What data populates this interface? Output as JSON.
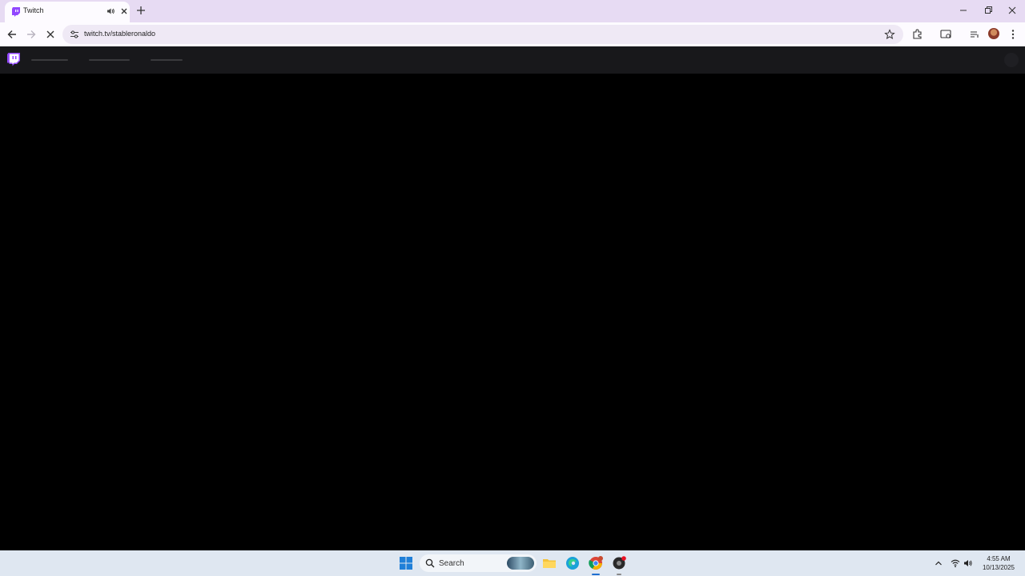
{
  "browser": {
    "tab": {
      "title": "Twitch",
      "favicon": "twitch-icon",
      "audio_icon": "speaker-icon",
      "close_icon": "close-icon"
    },
    "new_tab_icon": "plus-icon",
    "window_controls": [
      "minimize-icon",
      "restore-icon",
      "close-icon"
    ],
    "toolbar": {
      "back_icon": "arrow-left-icon",
      "forward_icon": "arrow-right-icon",
      "stop_icon": "close-icon",
      "site_info_icon": "tune-icon",
      "url": "twitch.tv/stableronaldo",
      "bookmark_icon": "star-icon",
      "extensions_icon": "puzzle-icon",
      "cast_icon": "media-cast-icon",
      "reading_list_icon": "queue-icon",
      "profile_icon": "avatar",
      "menu_icon": "kebab-menu-icon"
    }
  },
  "twitch": {
    "logo": "twitch-glitch-icon",
    "nav_state": "loading-skeleton",
    "colors": {
      "brand": "#9146ff",
      "nav_bg": "#18181b",
      "content_bg": "#000000"
    }
  },
  "taskbar": {
    "start_icon": "windows-icon",
    "search_label": "Search",
    "apps": [
      "file-explorer-icon",
      "edge-icon",
      "chrome-icon",
      "app-icon"
    ],
    "tray": [
      "chevron-up-icon",
      "wifi-icon",
      "volume-icon"
    ],
    "time": "4:55 AM",
    "date": "10/13/2025"
  }
}
